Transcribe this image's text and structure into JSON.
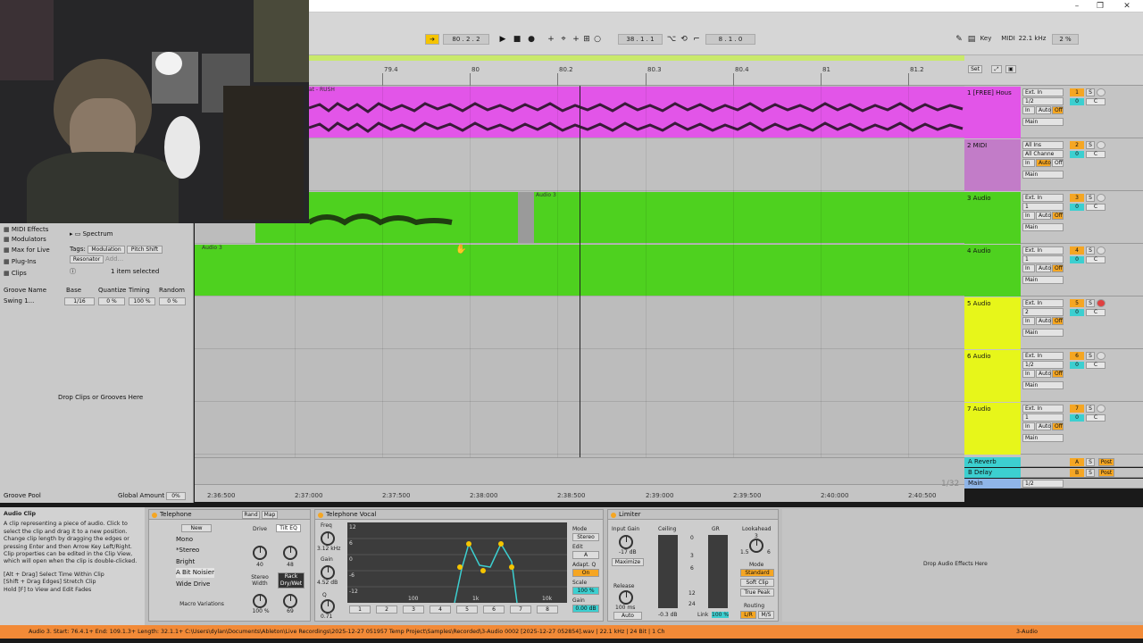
{
  "transport": {
    "tempo_pos": "80 . 2 . 2",
    "loop_start": "38 . 1 . 1",
    "loop_len": "8 . 1 . 0",
    "key_label": "Key",
    "midi_label": "MIDI",
    "sample_rate": "22.1 kHz",
    "cpu": "2 %"
  },
  "ruler": {
    "bars": [
      "79.4",
      "80",
      "80.2",
      "80.3",
      "80.4",
      "81",
      "81.2"
    ],
    "set_label": "Set"
  },
  "timeline": {
    "times": [
      "2:36:500",
      "2:37:000",
      "2:37:500",
      "2:38:000",
      "2:38:500",
      "2:39:000",
      "2:39:500",
      "2:40:000",
      "2:40:500"
    ],
    "zoom": "1/32"
  },
  "clips": {
    "track1": "at - RUSH",
    "track3": "Audio 3",
    "track4": "Audio 3"
  },
  "tracks": [
    {
      "name": "1 [FREE] Hous",
      "input": "Ext. In",
      "channel": "1/2",
      "output": "Main",
      "num": "1",
      "vol": "0"
    },
    {
      "name": "2 MIDI",
      "input": "All Ins",
      "channel": "All Channe",
      "output": "Main",
      "num": "2",
      "vol": "0"
    },
    {
      "name": "3 Audio",
      "input": "Ext. In",
      "channel": "1",
      "output": "Main",
      "num": "3",
      "vol": "0"
    },
    {
      "name": "4 Audio",
      "input": "Ext. In",
      "channel": "1",
      "output": "Main",
      "num": "4",
      "vol": "0"
    },
    {
      "name": "5 Audio",
      "input": "Ext. In",
      "channel": "2",
      "output": "Main",
      "num": "5",
      "vol": "0"
    },
    {
      "name": "6 Audio",
      "input": "Ext. In",
      "channel": "1/2",
      "output": "Main",
      "num": "6",
      "vol": "0"
    },
    {
      "name": "7 Audio",
      "input": "Ext. In",
      "channel": "1",
      "output": "Main",
      "num": "7",
      "vol": "0"
    }
  ],
  "monitor": {
    "in": "In",
    "auto": "Auto",
    "off": "Off"
  },
  "returns": [
    {
      "name": "A Reverb",
      "num": "A",
      "post": "Post"
    },
    {
      "name": "B Delay",
      "num": "B",
      "post": "Post"
    },
    {
      "name": "Main",
      "num": "",
      "post": "1/2"
    }
  ],
  "browser": {
    "categories": [
      "MIDI Effects",
      "Modulators",
      "Max for Live",
      "Plug-Ins",
      "Clips"
    ],
    "folder": "Spectrum",
    "tags_label": "Tags:",
    "tags": [
      "Modulation",
      "Pitch Shift",
      "Resonator",
      "Add..."
    ],
    "selected": "1 item selected"
  },
  "groove": {
    "headers": [
      "Groove Name",
      "Base",
      "Quantize",
      "Timing",
      "Random"
    ],
    "row": {
      "name": "Swing 1...",
      "base": "1/16",
      "quantize": "0 %",
      "timing": "100 %",
      "random": "0 %"
    },
    "drop": "Drop Clips or Grooves Here",
    "pool": "Groove Pool",
    "global": "Global Amount",
    "global_val": "0%"
  },
  "info": {
    "title": "Audio Clip",
    "body": "A clip representing a piece of audio. Click to select the clip and drag it to a new position. Change clip length by dragging the edges or pressing Enter and then Arrow Key Left/Right. Clip properties can be edited in the Clip View, which will open when the clip is double-clicked.",
    "shortcuts": [
      "[Alt + Drag] Select Time Within Clip",
      "[Shift + Drag Edges] Stretch Clip",
      "Hold [F] to View and Edit Fades"
    ]
  },
  "rack": {
    "title": "Telephone",
    "rand": "Rand",
    "map": "Map",
    "new": "New",
    "chains": [
      "Mono",
      "*Stereo",
      "Bright",
      "A Bit Noisier",
      "Wide Drive"
    ],
    "macro": "Macro Variations",
    "drive": "Drive",
    "tilt": "Tilt EQ",
    "drive_val": "40",
    "tilt_val": "48",
    "width": "Stereo Width",
    "width_val": "100 %",
    "drywet": "Rack Dry/Wet",
    "drywet_val": "69"
  },
  "eq": {
    "title": "Telephone Vocal",
    "freq": "Freq",
    "freq_val": "3.12 kHz",
    "gain": "Gain",
    "gain_val": "4.52 dB",
    "q": "Q",
    "q_val": "0.71",
    "db_labels": [
      "12",
      "6",
      "0",
      "-6",
      "-12"
    ],
    "freq_labels": [
      "100",
      "1k",
      "10k"
    ],
    "mode": "Mode",
    "mode_val": "Stereo",
    "edit": "Edit",
    "edit_val": "A",
    "adapt": "Adapt. Q",
    "adapt_val": "On",
    "scale": "Scale",
    "scale_val": "100 %",
    "gain_out": "Gain",
    "gain_out_val": "0.00 dB",
    "bands": [
      "1",
      "2",
      "3",
      "4",
      "5",
      "6",
      "7",
      "8"
    ]
  },
  "limiter": {
    "title": "Limiter",
    "input": "Input Gain",
    "input_val": "-17 dB",
    "maximize": "Maximize",
    "ceiling": "Ceiling",
    "gr": "GR",
    "scale": [
      "0",
      "3",
      "6",
      "12",
      "24"
    ],
    "ceiling_val": "-0.3 dB",
    "link": "Link",
    "link_val": "100 %",
    "release": "Release",
    "release_val": "100 ms",
    "auto": "Auto",
    "lookahead": "Lookahead",
    "look_vals": [
      "1.5",
      "3",
      "6"
    ],
    "mode": "Mode",
    "modes": [
      "Standard",
      "Soft Clip",
      "True Peak"
    ],
    "routing": "Routing",
    "routes": [
      "L/R",
      "M/S"
    ]
  },
  "drop_effects": "Drop Audio Effects Here",
  "status": {
    "text": "Audio 3. Start: 76.4.1+ End: 109.1.3+ Length: 32.1.1+ C:\\Users\\dylan\\Documents\\Ableton\\Live Recordings\\2025-12-27 051957 Temp Project\\Samples\\Recorded\\3-Audio 0002 [2025-12-27 052854].wav | 22.1 kHz | 24 Bit | 1 Ch",
    "track": "3-Audio"
  },
  "colors": {
    "track1": "#e255e8",
    "track3": "#4ed11f",
    "track5": "#e7f61a",
    "accent": "#f5a623",
    "cyan": "#3ccfd0"
  }
}
